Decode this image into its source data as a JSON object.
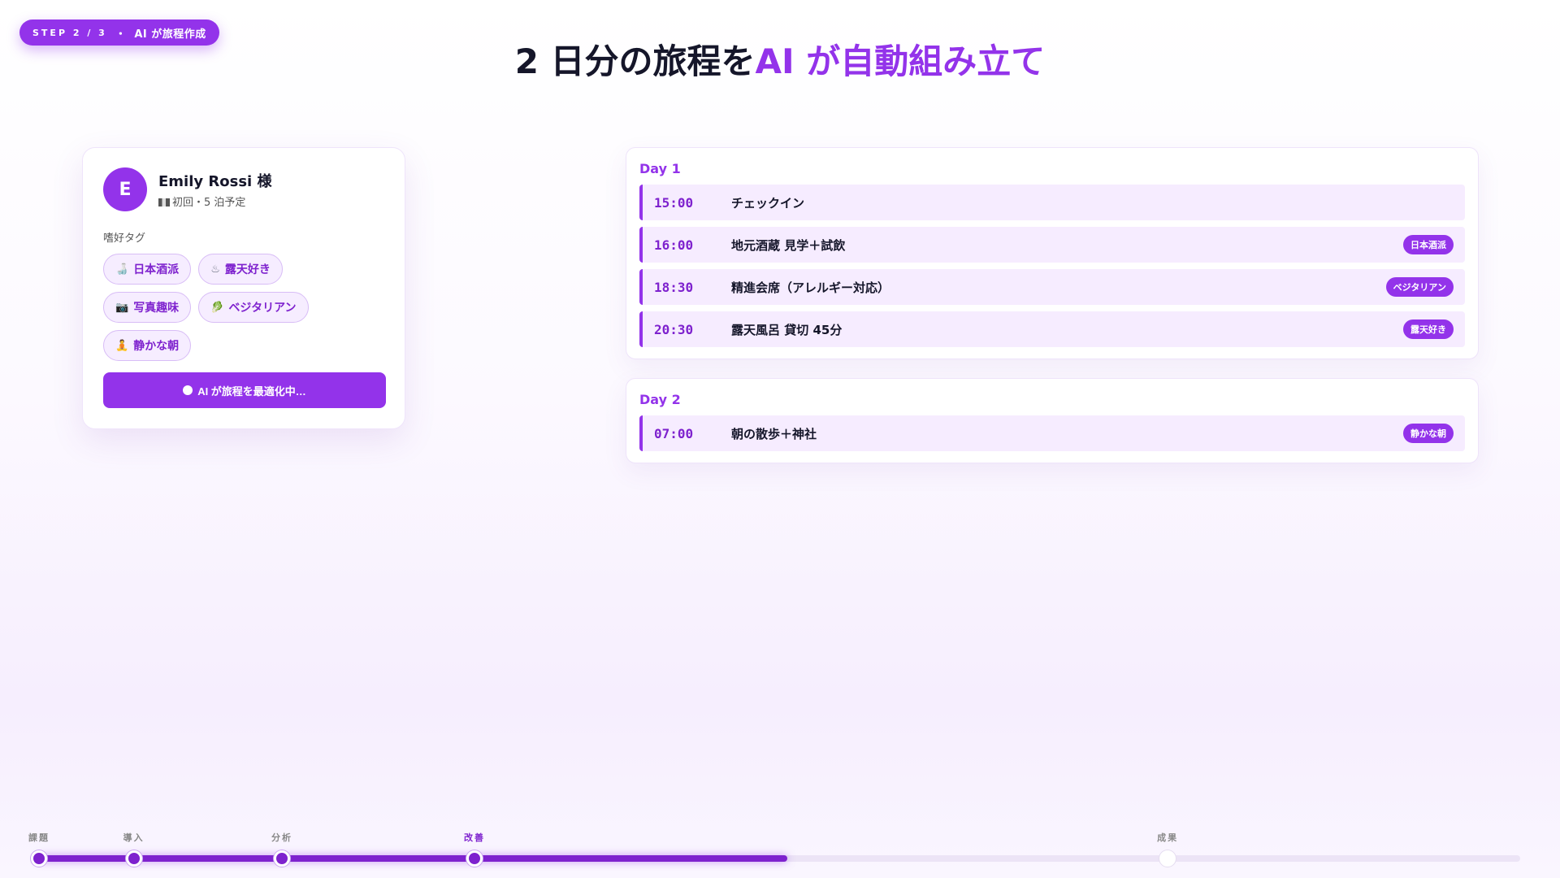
{
  "step": {
    "number": "STEP 2 / 3",
    "separator": "・",
    "label": "AI が旅程作成"
  },
  "title": {
    "main": "2 日分の旅程を",
    "accent": "AI が自動組み立て"
  },
  "guest": {
    "initial": "E",
    "name": "Emily Rossi 様",
    "subtitle": "初回・5 泊予定",
    "flag_icon": "flag-icon",
    "tags_label": "嗜好タグ",
    "tags": [
      {
        "icon": "sake-bottle-icon",
        "glyph": "🍶",
        "label": "日本酒派"
      },
      {
        "icon": "hot-spring-icon",
        "glyph": "♨",
        "label": "露天好き"
      },
      {
        "icon": "camera-icon",
        "glyph": "📷",
        "label": "写真趣味"
      },
      {
        "icon": "leaf-icon",
        "glyph": "🥬",
        "label": "ベジタリアン"
      },
      {
        "icon": "meditation-icon",
        "glyph": "🧘",
        "label": "静かな朝"
      }
    ],
    "button_label": "AI が旅程を最適化中…"
  },
  "days": [
    {
      "title": "Day 1",
      "events": [
        {
          "time": "15:00",
          "title": "チェックイン",
          "tag": ""
        },
        {
          "time": "16:00",
          "title": "地元酒蔵 見学＋試飲",
          "tag": "日本酒派"
        },
        {
          "time": "18:30",
          "title": "精進会席（アレルギー対応）",
          "tag": "ベジタリアン"
        },
        {
          "time": "20:30",
          "title": "露天風呂 貸切 45分",
          "tag": "露天好き"
        }
      ]
    },
    {
      "title": "Day 2",
      "events": [
        {
          "time": "07:00",
          "title": "朝の散歩＋神社",
          "tag": "静かな朝"
        }
      ]
    }
  ],
  "timeline": {
    "progress": 0.505,
    "nodes": [
      {
        "label": "課題",
        "pos": 0.0,
        "state": "done"
      },
      {
        "label": "導入",
        "pos": 0.064,
        "state": "done"
      },
      {
        "label": "分析",
        "pos": 0.164,
        "state": "done"
      },
      {
        "label": "改善",
        "pos": 0.294,
        "state": "active"
      },
      {
        "label": "成果",
        "pos": 0.762,
        "state": "future"
      }
    ]
  },
  "colors": {
    "accent": "#9333ea",
    "accent_dark": "#7e22ce",
    "tag_bg": "#f6edff"
  }
}
